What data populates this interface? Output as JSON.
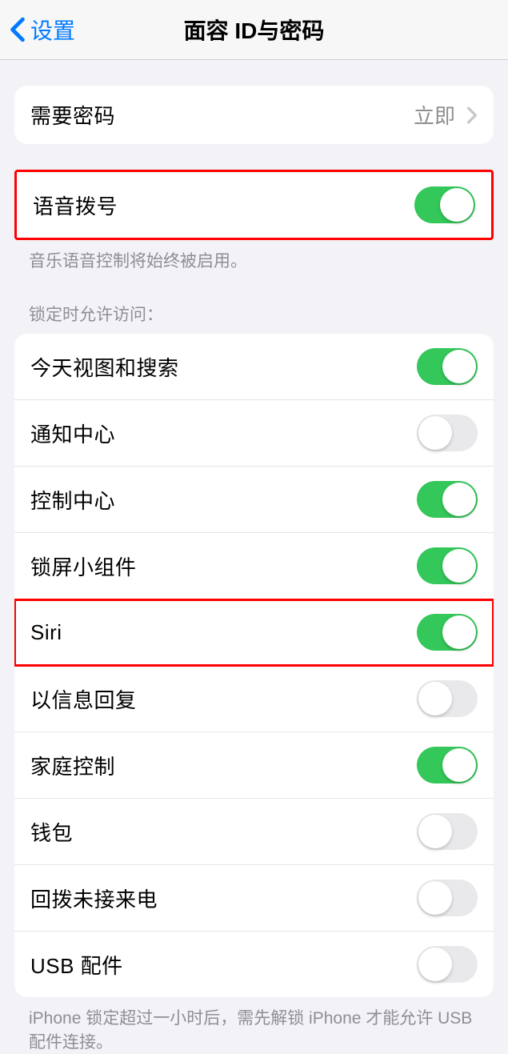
{
  "header": {
    "back_label": "设置",
    "title": "面容 ID与密码"
  },
  "require_passcode": {
    "label": "需要密码",
    "value": "立即"
  },
  "voice_dial": {
    "label": "语音拨号",
    "enabled": true,
    "footer": "音乐语音控制将始终被启用。"
  },
  "locked_access": {
    "header": "锁定时允许访问：",
    "items": [
      {
        "label": "今天视图和搜索",
        "enabled": true
      },
      {
        "label": "通知中心",
        "enabled": false
      },
      {
        "label": "控制中心",
        "enabled": true
      },
      {
        "label": "锁屏小组件",
        "enabled": true
      },
      {
        "label": "Siri",
        "enabled": true
      },
      {
        "label": "以信息回复",
        "enabled": false
      },
      {
        "label": "家庭控制",
        "enabled": true
      },
      {
        "label": "钱包",
        "enabled": false
      },
      {
        "label": "回拨未接来电",
        "enabled": false
      },
      {
        "label": "USB 配件",
        "enabled": false
      }
    ],
    "footer": "iPhone 锁定超过一小时后，需先解锁 iPhone 才能允许 USB 配件连接。"
  }
}
